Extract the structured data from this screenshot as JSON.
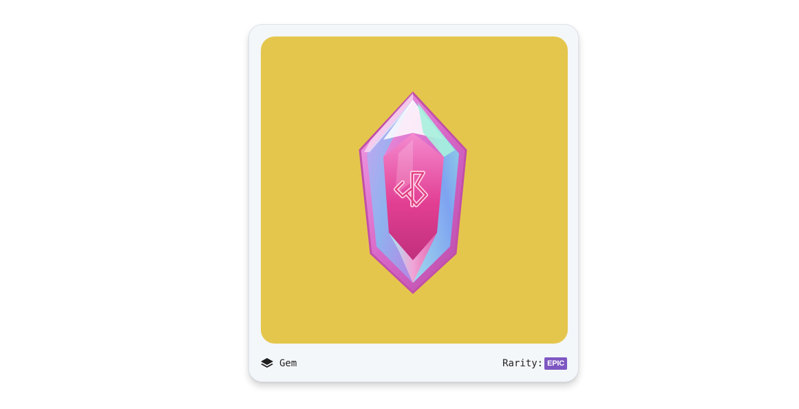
{
  "card": {
    "image": {
      "background_color": "#e5c64d",
      "subject": "pink-crystal-gem-with-rune"
    },
    "type": {
      "icon": "layers-icon",
      "label": "Gem"
    },
    "rarity": {
      "label": "Rarity:",
      "value": "EPIC",
      "badge_color": "#7e57c2"
    }
  }
}
